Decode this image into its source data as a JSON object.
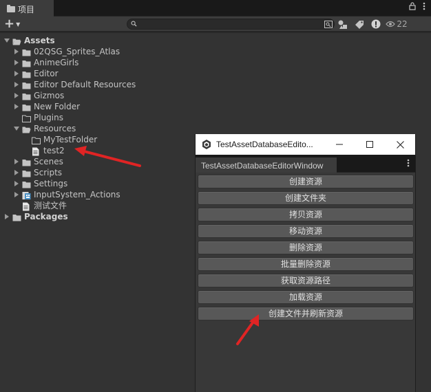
{
  "panel": {
    "tab_label": "项目",
    "hidden_count": "22"
  },
  "tree": [
    {
      "label": "Assets",
      "depth": 0,
      "expanded": true,
      "type": "folder-open",
      "bold": true
    },
    {
      "label": "02QSG_Sprites_Atlas",
      "depth": 1,
      "expanded": false,
      "type": "folder"
    },
    {
      "label": "AnimeGirls",
      "depth": 1,
      "expanded": false,
      "type": "folder"
    },
    {
      "label": "Editor",
      "depth": 1,
      "expanded": false,
      "type": "folder"
    },
    {
      "label": "Editor Default Resources",
      "depth": 1,
      "expanded": false,
      "type": "folder"
    },
    {
      "label": "Gizmos",
      "depth": 1,
      "expanded": false,
      "type": "folder"
    },
    {
      "label": "New Folder",
      "depth": 1,
      "expanded": false,
      "type": "folder"
    },
    {
      "label": "Plugins",
      "depth": 1,
      "expanded": null,
      "type": "folder-empty"
    },
    {
      "label": "Resources",
      "depth": 1,
      "expanded": true,
      "type": "folder-open"
    },
    {
      "label": "MyTestFolder",
      "depth": 2,
      "expanded": null,
      "type": "folder-empty"
    },
    {
      "label": "test2",
      "depth": 2,
      "expanded": null,
      "type": "file"
    },
    {
      "label": "Scenes",
      "depth": 1,
      "expanded": false,
      "type": "folder"
    },
    {
      "label": "Scripts",
      "depth": 1,
      "expanded": false,
      "type": "folder"
    },
    {
      "label": "Settings",
      "depth": 1,
      "expanded": false,
      "type": "folder"
    },
    {
      "label": "InputSystem_Actions",
      "depth": 1,
      "expanded": false,
      "type": "input-asset"
    },
    {
      "label": "测试文件",
      "depth": 1,
      "expanded": null,
      "type": "file"
    },
    {
      "label": "Packages",
      "depth": 0,
      "expanded": false,
      "type": "folder",
      "bold": true
    }
  ],
  "window": {
    "title": "TestAssetDatabaseEdito...",
    "tab_label": "TestAssetDatabaseEditorWindow",
    "buttons": [
      "创建资源",
      "创建文件夹",
      "拷贝资源",
      "移动资源",
      "删除资源",
      "批量删除资源",
      "获取资源路径",
      "加载资源",
      "创建文件并刷新资源"
    ]
  },
  "colors": {
    "annotation_arrow": "#e02424",
    "folder": "#c4c4c4"
  }
}
